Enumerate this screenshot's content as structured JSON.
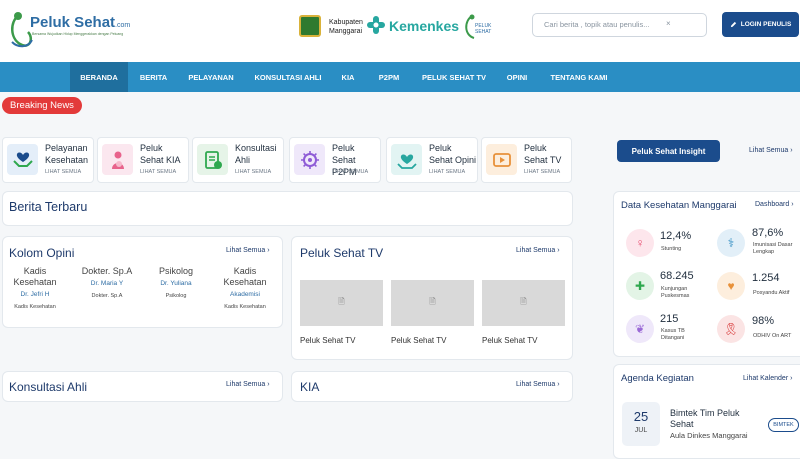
{
  "header": {
    "logo_main": "Peluk Sehat",
    "logo_suffix": ".com",
    "logo_tagline": "Bersama Wujudkan Hidup Menggerakkan dengan Peluang",
    "kab_line1": "Kabupaten",
    "kab_line2": "Manggarai",
    "kemenkes": "Kemenkes",
    "search_placeholder": "Cari berita , topik atau penulis...",
    "login_label": "LOGIN PENULIS"
  },
  "nav": [
    "BERANDA",
    "BERITA",
    "PELAYANAN",
    "KONSULTASI AHLI",
    "KIA",
    "P2PM",
    "PELUK SEHAT TV",
    "OPINI",
    "TENTANG KAMI"
  ],
  "breaking": "Breaking News",
  "services": [
    {
      "title": "Pelayanan Kesehatan",
      "sub": "LIHAT SEMUA",
      "icon": "heart-hands-icon"
    },
    {
      "title": "Peluk Sehat KIA",
      "sub": "LIHAT SEMUA",
      "icon": "mother-child-icon"
    },
    {
      "title": "Konsultasi Ahli",
      "sub": "LIHAT SEMUA",
      "icon": "clipboard-apple-icon"
    },
    {
      "title": "Peluk Sehat P2PM",
      "sub": "LIHAT SEMUA",
      "icon": "virus-icon"
    },
    {
      "title": "Peluk Sehat Opini",
      "sub": "LIHAT SEMUA",
      "icon": "heart-care-icon"
    },
    {
      "title": "Peluk Sehat TV",
      "sub": "LIHAT SEMUA",
      "icon": "play-icon"
    }
  ],
  "berita_terbaru": "Berita Terbaru",
  "kolom_opini": {
    "title": "Kolom Opini",
    "link": "Lihat Semua",
    "items": [
      {
        "img_alt": "Kadis Kesehatan",
        "name": "Dr. Jefri H",
        "role": "Kadis Kesehatan"
      },
      {
        "img_alt": "Dokter. Sp.A",
        "name": "Dr. Maria Y",
        "role": "Dokter. Sp.A"
      },
      {
        "img_alt": "Psikolog",
        "name": "Dr. Yuliana",
        "role": "Psikolog"
      },
      {
        "img_alt": "Kadis Kesehatan",
        "name": "Akademisi",
        "role": "Kadis Kesehatan"
      }
    ]
  },
  "tv": {
    "title": "Peluk Sehat TV",
    "link": "Lihat Semua",
    "items": [
      "Peluk Sehat TV",
      "Peluk Sehat TV",
      "Peluk Sehat TV"
    ]
  },
  "konsultasi": {
    "title": "Konsultasi Ahli",
    "link": "Lihat Semua"
  },
  "kia": {
    "title": "KIA",
    "link": "Lihat Semua"
  },
  "insight": {
    "tab": "Peluk Sehat Insight",
    "link": "Lihat Semua"
  },
  "data_kesehatan": {
    "title": "Data Kesehatan Manggarai",
    "link": "Dashboard",
    "stats": [
      {
        "value": "12,4%",
        "label": "Stunting",
        "color": "#e84a6f"
      },
      {
        "value": "87,6%",
        "label": "Imunisasi Dasar Lengkap",
        "color": "#2e8bc0"
      },
      {
        "value": "68.245",
        "label": "Kunjungan Puskesmas",
        "color": "#2fa84f"
      },
      {
        "value": "1.254",
        "label": "Posyandu Aktif",
        "color": "#e8913a"
      },
      {
        "value": "215",
        "label": "Kasus TB Ditangani",
        "color": "#9b6ad6"
      },
      {
        "value": "98%",
        "label": "ODHIV On ART",
        "color": "#d62f2f"
      }
    ]
  },
  "agenda": {
    "title": "Agenda Kegiatan",
    "link": "Lihat Kalender",
    "day": "25",
    "month": "JUL",
    "event_title": "Bimtek Tim Peluk Sehat",
    "event_place": "Aula Dinkes Manggarai",
    "badge": "BIMTEK"
  }
}
